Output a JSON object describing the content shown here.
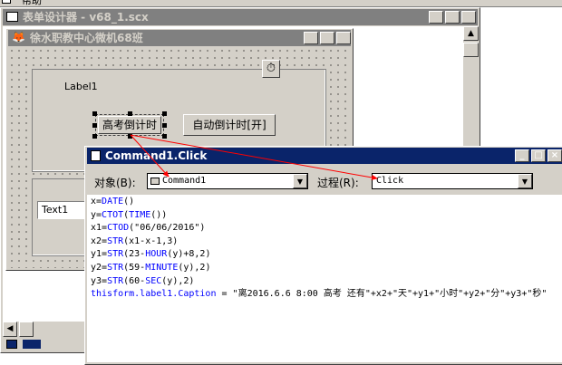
{
  "top_menu": {
    "label": "帮助"
  },
  "designer": {
    "title": "表单设计器 - v68_1.scx"
  },
  "form": {
    "title": "徐水职教中心微机68班",
    "label1": "Label1",
    "cmd_countdown": "高考倒计时",
    "cmd_auto": "自动倒计时[开]",
    "text1": "Text1"
  },
  "code_window": {
    "title": "Command1.Click",
    "object_label": "对象(B):",
    "object_value": "Command1",
    "procedure_label": "过程(R):",
    "procedure_value": "Click",
    "lines": [
      {
        "fn": "",
        "text": "x=DATE()"
      },
      {
        "fn": "",
        "text": "y=CTOT(TIME())"
      },
      {
        "fn": "",
        "text": "x1=CTOD(\"06/06/2016\")"
      },
      {
        "fn": "",
        "text": "x2=STR(x1-x-1,3)"
      },
      {
        "fn": "",
        "text": "y1=STR(23-HOUR(y)+8,2)"
      },
      {
        "fn": "",
        "text": "y2=STR(59-MINUTE(y),2)"
      },
      {
        "fn": "",
        "text": "y3=STR(60-SEC(y),2)"
      },
      {
        "fn": "kw",
        "text": "thisform.label1.Caption = \"离2016.6.6 8:00 高考 还有\"+x2+\"天\"+y1+\"小时\"+y2+\"分\"+y3+\"秒\""
      }
    ]
  },
  "colors": {
    "title_active": "#0a246a",
    "title_inactive": "#808080",
    "face": "#d4d0c8",
    "arrow": "#ff0000"
  }
}
